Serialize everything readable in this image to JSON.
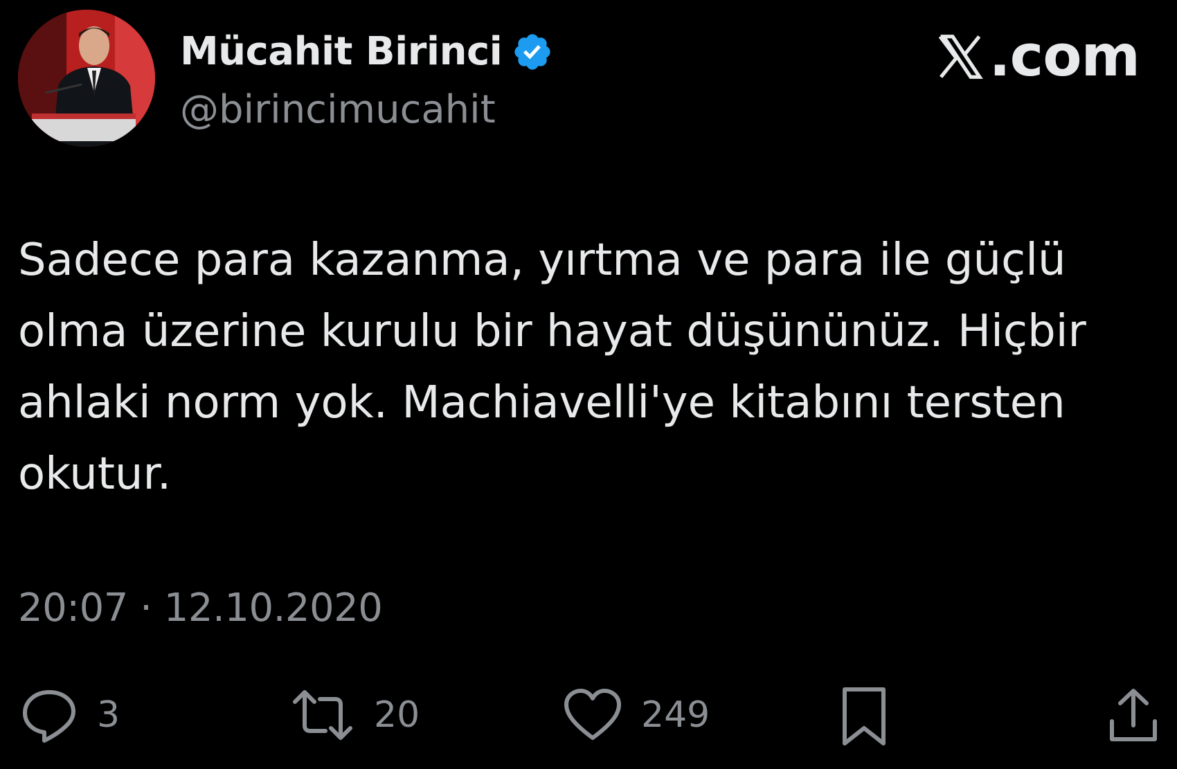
{
  "author": {
    "display_name": "Mücahit Birinci",
    "handle": "@birincimucahit",
    "verified": true,
    "verified_color": "#1d9bf0"
  },
  "brand": {
    "label": ".com",
    "icon": "x-logo-icon"
  },
  "tweet": {
    "text": "Sadece para kazanma, yırtma ve para ile güçlü olma üzerine kurulu bir hayat düşününüz. Hiçbir ahlaki norm yok. Machiavelli'ye kitabını tersten okutur.",
    "timestamp": "20:07 · 12.10.2020"
  },
  "actions": {
    "reply": {
      "icon": "reply-icon",
      "count": "3"
    },
    "retweet": {
      "icon": "retweet-icon",
      "count": "20"
    },
    "like": {
      "icon": "heart-icon",
      "count": "249"
    },
    "bookmark": {
      "icon": "bookmark-icon"
    },
    "share": {
      "icon": "share-icon"
    }
  },
  "colors": {
    "background": "#000000",
    "text_primary": "#e7e9ea",
    "text_secondary": "#8b8f94"
  }
}
